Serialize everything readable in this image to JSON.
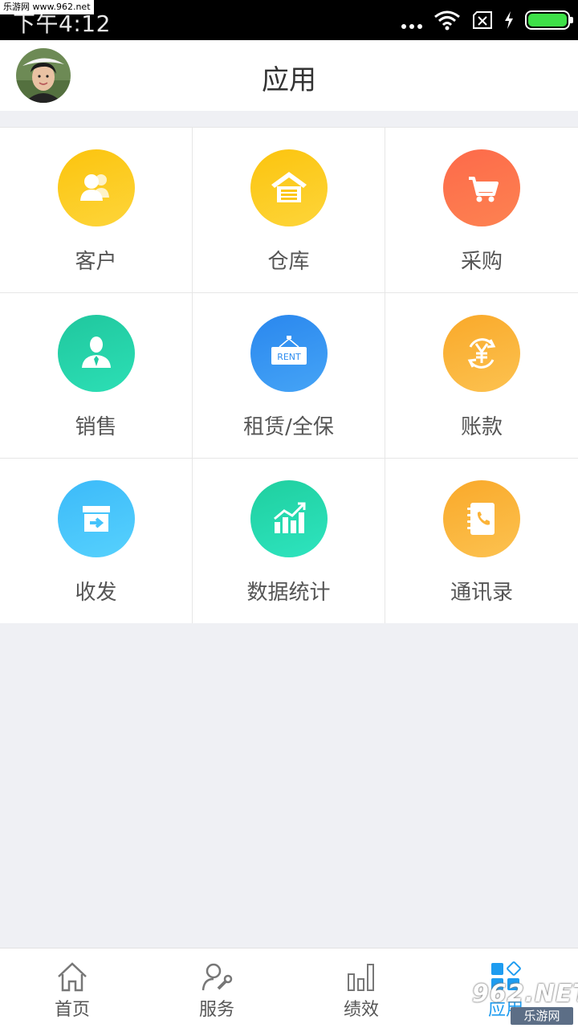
{
  "status_bar": {
    "time": "下午4:12",
    "watermark": "乐游网 www.962.net",
    "battery_color": "#3ee048"
  },
  "header": {
    "title": "应用",
    "avatar_icon": "user-avatar"
  },
  "apps": [
    {
      "label": "客户",
      "icon": "customers-icon",
      "color": "#fdc411"
    },
    {
      "label": "仓库",
      "icon": "warehouse-icon",
      "color": "#fdc411"
    },
    {
      "label": "采购",
      "icon": "cart-icon",
      "color": "#fd6f4d"
    },
    {
      "label": "销售",
      "icon": "salesperson-icon",
      "color": "#23d0a6"
    },
    {
      "label": "租赁/全保",
      "icon": "rent-sign-icon",
      "sign_text": "RENT",
      "color": "#2e8df0"
    },
    {
      "label": "账款",
      "icon": "yen-cycle-icon",
      "color": "#fbb338"
    },
    {
      "label": "收发",
      "icon": "inbox-arrow-icon",
      "color": "#44c3fb"
    },
    {
      "label": "数据统计",
      "icon": "growth-chart-icon",
      "color": "#23d6ad"
    },
    {
      "label": "通讯录",
      "icon": "contacts-book-icon",
      "color": "#fbb338"
    }
  ],
  "tabbar": {
    "items": [
      {
        "label": "首页",
        "icon": "home-icon",
        "active": false
      },
      {
        "label": "服务",
        "icon": "service-icon",
        "active": false
      },
      {
        "label": "绩效",
        "icon": "bar-chart-icon",
        "active": false
      },
      {
        "label": "应用",
        "icon": "apps-grid-icon",
        "active": true
      }
    ],
    "active_color": "#1e9cf0"
  },
  "watermark_bottom": {
    "number": "962.NET",
    "text": "乐游网"
  }
}
